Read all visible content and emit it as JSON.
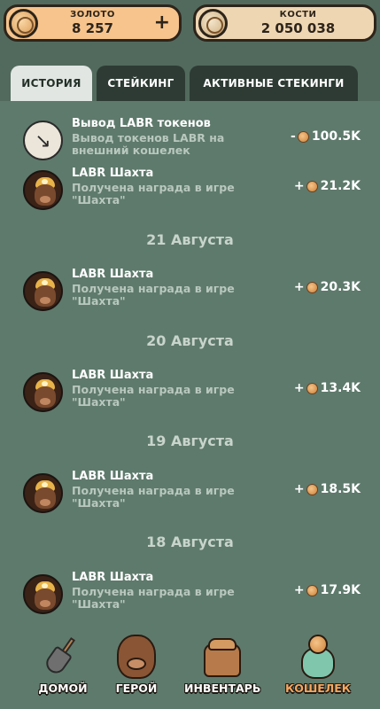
{
  "header": {
    "gold": {
      "label": "ЗОЛОТО",
      "value": "8 257",
      "icon": "coin-icon",
      "add": "+"
    },
    "bones": {
      "label": "КОСТИ",
      "value": "2 050 038",
      "icon": "bone-coin-icon"
    }
  },
  "tabs": [
    {
      "label": "ИСТОРИЯ",
      "active": true
    },
    {
      "label": "СТЕЙКИНГ",
      "active": false
    },
    {
      "label": "АКТИВНЫЕ СТЕКИНГИ",
      "active": false
    }
  ],
  "history": [
    {
      "type": "transaction",
      "title": "Вывод LABR токенов",
      "desc": "Вывод токенов LABR на внешний кошелек",
      "sign": "-",
      "amount": "100.5K",
      "icon": "withdraw-arrow-icon"
    },
    {
      "type": "transaction",
      "title": "LABR Шахта",
      "desc": "Получена награда в игре \"Шахта\"",
      "sign": "+",
      "amount": "21.2K",
      "icon": "miner-avatar-icon"
    },
    {
      "type": "date",
      "text": "21 Августа"
    },
    {
      "type": "transaction",
      "title": "LABR Шахта",
      "desc": "Получена награда в игре \"Шахта\"",
      "sign": "+",
      "amount": "20.3K",
      "icon": "miner-avatar-icon"
    },
    {
      "type": "date",
      "text": "20 Августа"
    },
    {
      "type": "transaction",
      "title": "LABR Шахта",
      "desc": "Получена награда в игре \"Шахта\"",
      "sign": "+",
      "amount": "13.4K",
      "icon": "miner-avatar-icon"
    },
    {
      "type": "date",
      "text": "19 Августа"
    },
    {
      "type": "transaction",
      "title": "LABR Шахта",
      "desc": "Получена награда в игре \"Шахта\"",
      "sign": "+",
      "amount": "18.5K",
      "icon": "miner-avatar-icon"
    },
    {
      "type": "date",
      "text": "18 Августа"
    },
    {
      "type": "transaction",
      "title": "LABR Шахта",
      "desc": "Получена награда в игре \"Шахта\"",
      "sign": "+",
      "amount": "17.9K",
      "icon": "miner-avatar-icon"
    }
  ],
  "nav": [
    {
      "label": "ДОМОЙ",
      "icon": "shovel-icon",
      "active": false
    },
    {
      "label": "ГЕРОЙ",
      "icon": "hero-dog-icon",
      "active": false
    },
    {
      "label": "ИНВЕНТАРЬ",
      "icon": "backpack-icon",
      "active": false
    },
    {
      "label": "КОШЕЛЕК",
      "icon": "money-sack-icon",
      "active": true
    }
  ],
  "colors": {
    "background": "#526a5d",
    "panel": "#5e7a6c",
    "tab_inactive": "#2e3b35",
    "tab_active": "#e1e6e3",
    "active_nav": "#f4a860"
  }
}
